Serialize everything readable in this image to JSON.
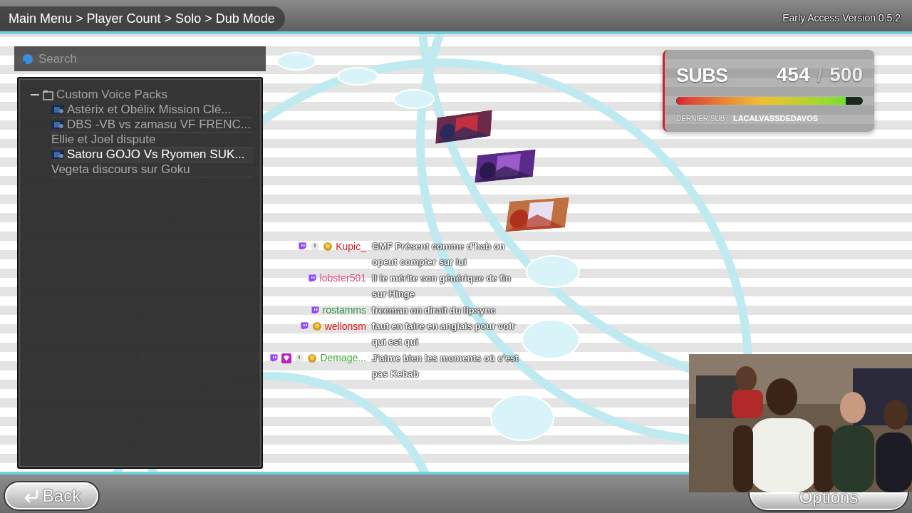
{
  "breadcrumb": "Main Menu > Player Count > Solo > Dub Mode",
  "version": "Early Access Version 0.5.2",
  "search": {
    "placeholder": "Search"
  },
  "tree": {
    "label": "Custom Voice Packs",
    "expanded": true,
    "children": [
      {
        "label": "Astérix et Obélix Mission Clé...",
        "thumbnail": true,
        "selected": false
      },
      {
        "label": "DBS -VB vs zamasu VF FRENC...",
        "thumbnail": true,
        "selected": false
      },
      {
        "label": "Ellie et Joel  dispute",
        "thumbnail": false,
        "selected": false
      },
      {
        "label": "Satoru GOJO Vs Ryomen SUK...",
        "thumbnail": true,
        "selected": true
      },
      {
        "label": "Vegeta discours sur Goku",
        "thumbnail": false,
        "selected": false
      }
    ]
  },
  "subs_widget": {
    "title": "SUBS",
    "current": "454",
    "separator": "/",
    "goal": "500",
    "level": 0.908,
    "last_label": "DERNIER SUB :",
    "last_name": "LACALVASSDEDAVOS"
  },
  "buttons": [
    {
      "label": "Back",
      "kind": "back"
    },
    {
      "label": "Options",
      "kind": "plain"
    }
  ],
  "chat": [
    {
      "user": "Kupic_",
      "color": "#d01c1c",
      "badges": [
        {
          "kind": "twitch"
        },
        {
          "kind": "circle"
        },
        {
          "kind": "avatar"
        }
      ],
      "text": "GMF Présent comme d'hab on opeut compter sur lui"
    },
    {
      "user": "lobster501",
      "color": "#e0457b",
      "badges": [
        {
          "kind": "twitch"
        }
      ],
      "text": "Il le mérite son générique de fin sur Hinge"
    },
    {
      "user": "rostamms",
      "color": "#2e8b3e",
      "badges": [
        {
          "kind": "twitch"
        }
      ],
      "text": "freeman on dirait du lipsync"
    },
    {
      "user": "wellonsm",
      "color": "#e01010",
      "badges": [
        {
          "kind": "twitch"
        },
        {
          "kind": "avatar"
        }
      ],
      "text": "faut en faire en anglais pour voir qui est qui"
    },
    {
      "user": "Demage...",
      "color": "#3aa83a",
      "badges": [
        {
          "kind": "twitch"
        },
        {
          "kind": "gem"
        },
        {
          "kind": "circle"
        },
        {
          "kind": "avatar"
        }
      ],
      "text": "J'aime bien les moments où c'est pas Kebab"
    }
  ]
}
